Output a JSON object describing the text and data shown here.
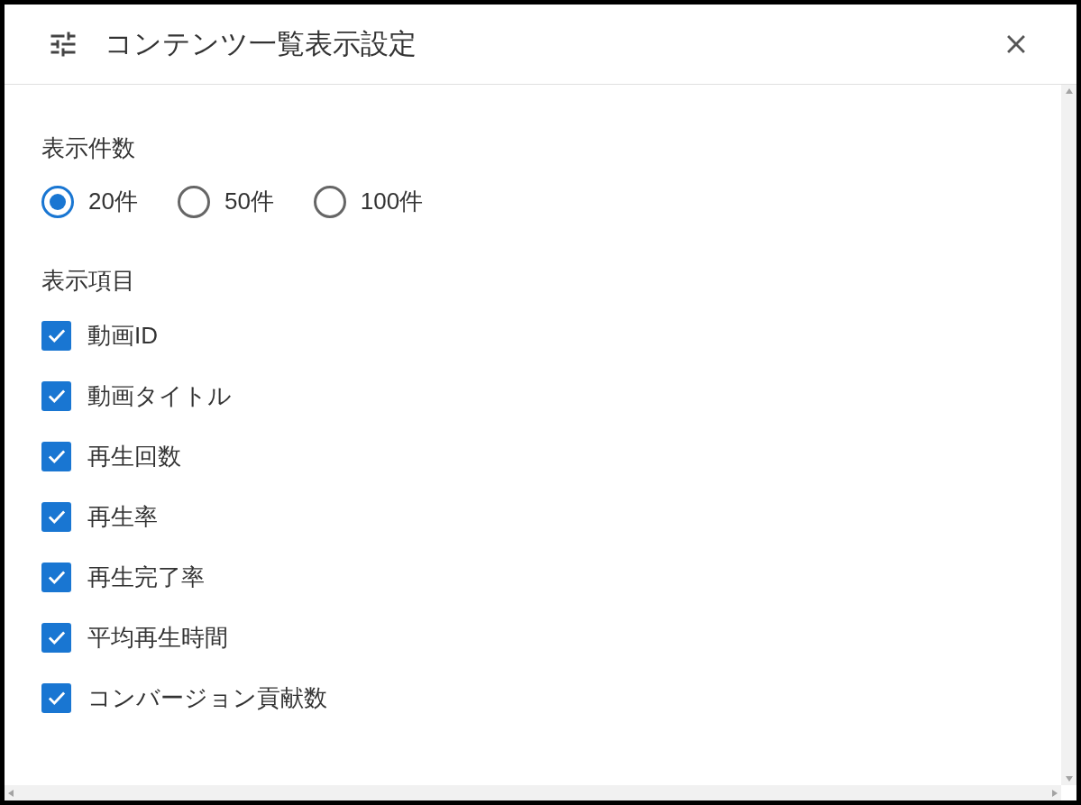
{
  "dialog": {
    "title": "コンテンツ一覧表示設定"
  },
  "sections": [
    {
      "kind": "radio",
      "heading": "表示件数",
      "options": [
        {
          "label": "20件",
          "selected": true
        },
        {
          "label": "50件",
          "selected": false
        },
        {
          "label": "100件",
          "selected": false
        }
      ]
    },
    {
      "kind": "checkbox",
      "heading": "表示項目",
      "options": [
        {
          "label": "動画ID",
          "checked": true
        },
        {
          "label": "動画タイトル",
          "checked": true
        },
        {
          "label": "再生回数",
          "checked": true
        },
        {
          "label": "再生率",
          "checked": true
        },
        {
          "label": "再生完了率",
          "checked": true
        },
        {
          "label": "平均再生時間",
          "checked": true
        },
        {
          "label": "コンバージョン貢献数",
          "checked": true
        }
      ]
    }
  ]
}
